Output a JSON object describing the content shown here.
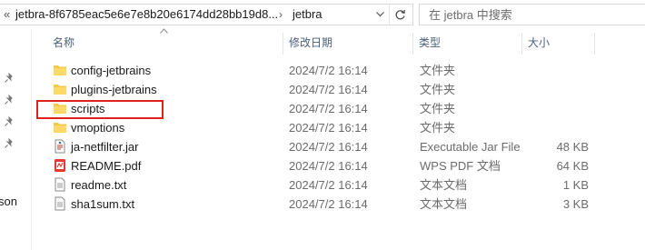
{
  "address": {
    "overflow_chevron": "«",
    "segments": [
      "jetbra-8f6785eac5e6e7e8b20e6174dd28bb19d8...",
      "jetbra"
    ],
    "separator": "›",
    "dropdown_icon": "chevron-down-icon",
    "refresh_icon": "refresh-icon"
  },
  "search": {
    "placeholder": "在 jetbra 中搜索"
  },
  "nav": {
    "partial_label": "son"
  },
  "columns": {
    "name": "名称",
    "date": "修改日期",
    "type": "类型",
    "size": "大小"
  },
  "files": [
    {
      "name": "config-jetbrains",
      "date": "2024/7/2 16:14",
      "type": "文件夹",
      "size": "",
      "icon": "folder-icon"
    },
    {
      "name": "plugins-jetbrains",
      "date": "2024/7/2 16:14",
      "type": "文件夹",
      "size": "",
      "icon": "folder-icon"
    },
    {
      "name": "scripts",
      "date": "2024/7/2 16:14",
      "type": "文件夹",
      "size": "",
      "icon": "folder-icon"
    },
    {
      "name": "vmoptions",
      "date": "2024/7/2 16:14",
      "type": "文件夹",
      "size": "",
      "icon": "folder-icon"
    },
    {
      "name": "ja-netfilter.jar",
      "date": "2024/7/2 16:14",
      "type": "Executable Jar File",
      "size": "48 KB",
      "icon": "jar-file-icon"
    },
    {
      "name": "README.pdf",
      "date": "2024/7/2 16:14",
      "type": "WPS PDF 文档",
      "size": "64 KB",
      "icon": "pdf-file-icon"
    },
    {
      "name": "readme.txt",
      "date": "2024/7/2 16:14",
      "type": "文本文档",
      "size": "1 KB",
      "icon": "text-file-icon"
    },
    {
      "name": "sha1sum.txt",
      "date": "2024/7/2 16:14",
      "type": "文本文档",
      "size": "3 KB",
      "icon": "text-file-icon"
    }
  ],
  "colors": {
    "highlight_box": "#e0201b",
    "folder": "#f3c84b",
    "header_text": "#4c607a"
  }
}
